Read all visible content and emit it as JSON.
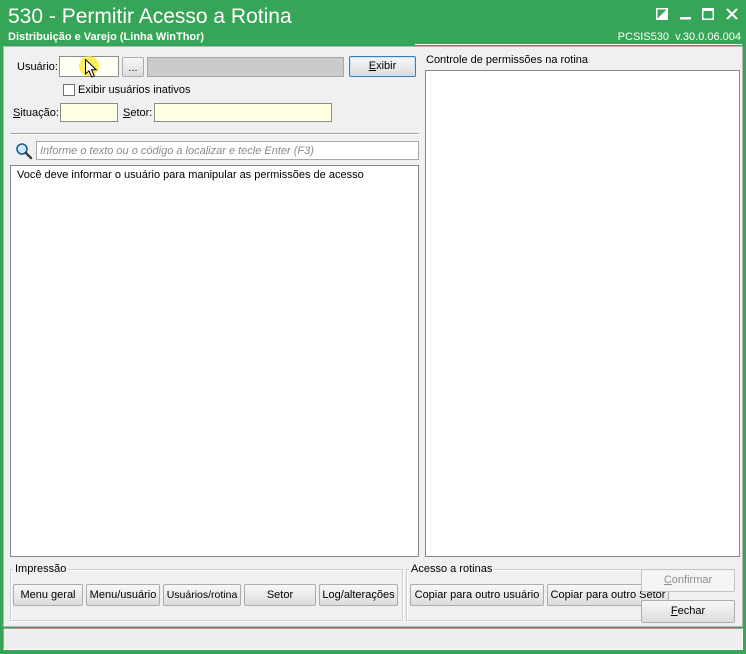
{
  "window": {
    "title": "530 - Permitir Acesso a Rotina",
    "subtitle": "Distribuição e Varejo (Linha WinThor)",
    "version": "PCSIS530  v.30.0.06.004",
    "control_icons": [
      "tile-icon",
      "minimize-icon",
      "maximize-icon",
      "close-icon"
    ]
  },
  "colors": {
    "titlebar": "#37a557",
    "panel_background": "#f0f0f0",
    "required_field": "#ffffe1",
    "focus_border": "#3c7fb1",
    "disabled_text": "#8f8f8f"
  },
  "user_filter": {
    "usuario_label": "Usuário:",
    "usuario_code": "",
    "browse_button_label": "...",
    "usuario_name": "",
    "exibir_button_label": "Exibir",
    "show_inactive_label": "Exibir usuários inativos",
    "show_inactive_checked": false,
    "situacao_label": "Situação:",
    "situacao_value": "",
    "setor_label": "Setor:",
    "setor_value": ""
  },
  "search": {
    "icon": "search-icon",
    "placeholder": "Informe o texto ou o código a localizar e tecle Enter (F3)",
    "value": ""
  },
  "routines_panel": {
    "message": "Você deve informar o usuário para manipular as permissões de acesso"
  },
  "permissions_panel": {
    "title": "Controle de permissões na rotina"
  },
  "impressao": {
    "legend": "Impressão",
    "buttons": [
      "Menu geral",
      "Menu/usuário",
      "Usuários/rotina",
      "Setor",
      "Log/alterações"
    ]
  },
  "acesso_rotinas": {
    "legend": "Acesso a rotinas",
    "buttons": [
      "Copiar para outro usuário",
      "Copiar para outro Setor"
    ]
  },
  "actions": {
    "confirmar_label": "Confirmar",
    "confirmar_enabled": false,
    "fechar_label": "Fechar"
  }
}
